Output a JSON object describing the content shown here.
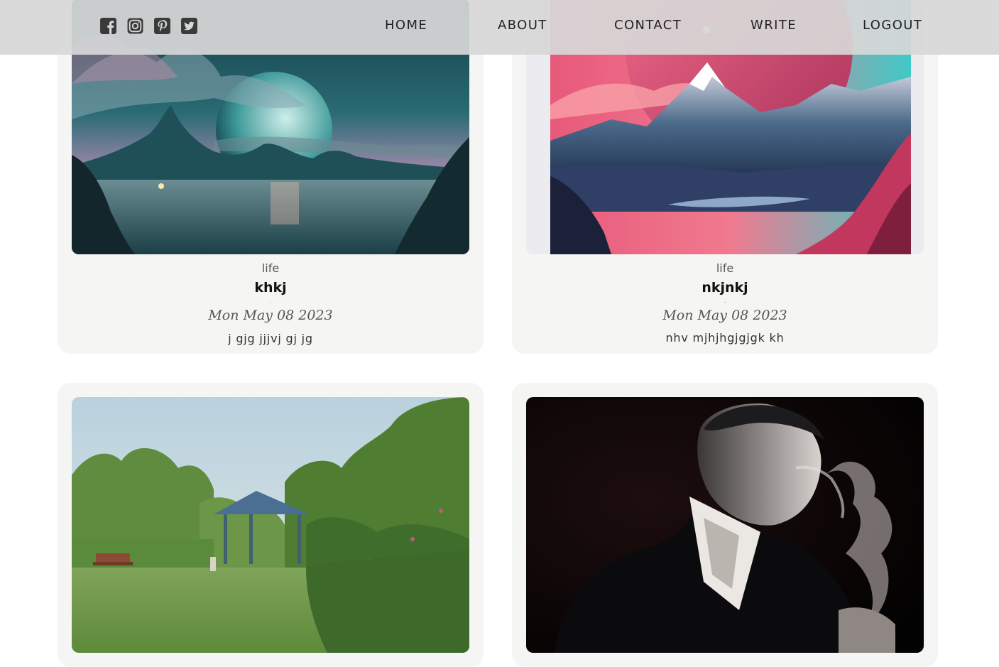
{
  "header": {
    "socials": [
      {
        "icon": "facebook-square-icon"
      },
      {
        "icon": "instagram-icon"
      },
      {
        "icon": "pinterest-icon"
      },
      {
        "icon": "twitter-square-icon"
      }
    ],
    "nav": {
      "home": "HOME",
      "about": "ABOUT",
      "contact": "CONTACT",
      "write": "WRITE",
      "logout": "LOGOUT"
    }
  },
  "posts": [
    {
      "image": "moon-lake-landscape",
      "category": "life",
      "title": "khkj",
      "date": "Mon May 08 2023",
      "desc": "j gjg jjjvj gj jg"
    },
    {
      "image": "pink-mountain-landscape",
      "category": "life",
      "title": "nkjnkj",
      "date": "Mon May 08 2023",
      "desc": "nhv mjhjhgjgjgk kh"
    },
    {
      "image": "park-gazebo-photo"
    },
    {
      "image": "smoking-man-portrait"
    }
  ],
  "colors": {
    "topbar": "#d7d7d7",
    "card": "#f5f5f3",
    "nav_text": "#222222"
  }
}
